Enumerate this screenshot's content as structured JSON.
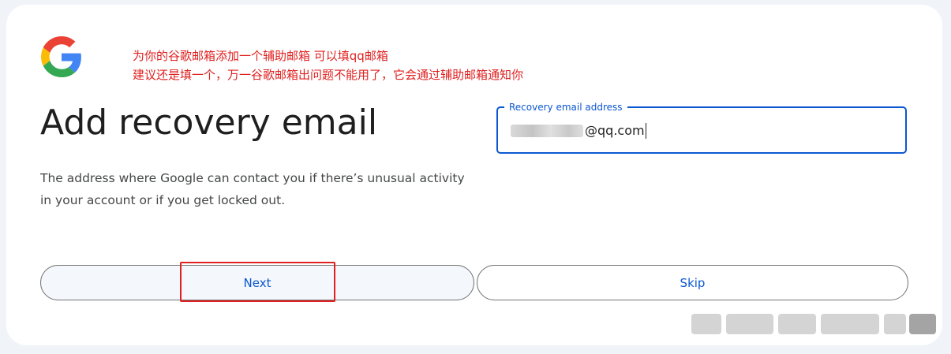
{
  "annotation": {
    "line1": "为你的谷歌邮箱添加一个辅助邮箱 可以填qq邮箱",
    "line2": "建议还是填一个，万一谷歌邮箱出问题不能用了，它会通过辅助邮箱通知你",
    "color": "#e02020"
  },
  "page": {
    "title": "Add recovery email",
    "description": "The address where Google can contact you if there’s unusual activity in your account or if you get locked out."
  },
  "recovery_field": {
    "label": "Recovery email address",
    "value_visible": "@qq.com"
  },
  "buttons": {
    "next_label": "Next",
    "skip_label": "Skip"
  },
  "icons": {
    "logo": "google-logo-icon"
  },
  "colors": {
    "accent": "#0b57d0",
    "text": "#1f1f1f",
    "muted": "#444746",
    "background": "#f0f4f9"
  }
}
